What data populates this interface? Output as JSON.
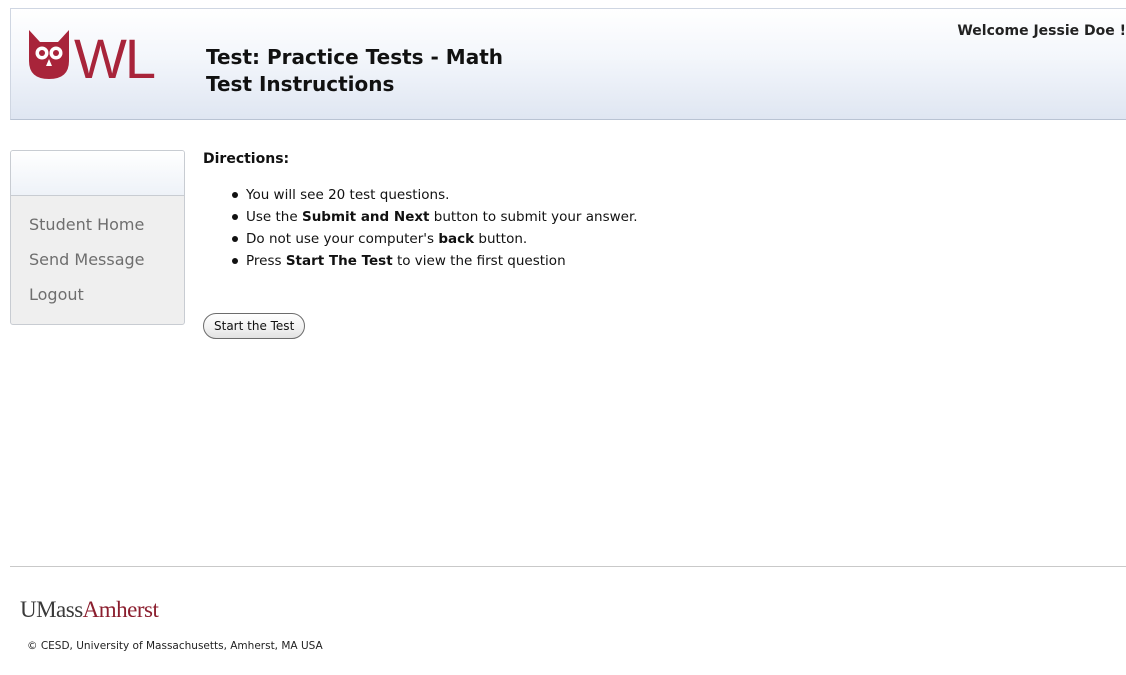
{
  "header": {
    "logo_text": "OWL",
    "title_line1": "Test: Practice Tests - Math",
    "title_line2": "Test Instructions",
    "welcome": "Welcome Jessie Doe !"
  },
  "sidebar": {
    "items": [
      {
        "label": "Student Home"
      },
      {
        "label": "Send Message"
      },
      {
        "label": "Logout"
      }
    ]
  },
  "main": {
    "directions_title": "Directions:",
    "directions": [
      {
        "before": "You will see 20 test questions.",
        "bold": "",
        "after": ""
      },
      {
        "before": "Use the ",
        "bold": "Submit and Next",
        "after": " button to submit your answer."
      },
      {
        "before": "Do not use your computer's ",
        "bold": "back",
        "after": " button."
      },
      {
        "before": "Press ",
        "bold": "Start The Test",
        "after": " to view the first question"
      }
    ],
    "start_button_label": "Start the Test"
  },
  "footer": {
    "logo_part1": "UMass",
    "logo_part2": "Amherst",
    "copyright": "© CESD, University of Massachusetts, Amherst, MA USA"
  },
  "colors": {
    "owl_brand": "#a8243a",
    "umass_maroon": "#8b1e2e",
    "sidebar_text": "#6e6e6e",
    "header_gradient_bottom": "#dfe6f2"
  }
}
